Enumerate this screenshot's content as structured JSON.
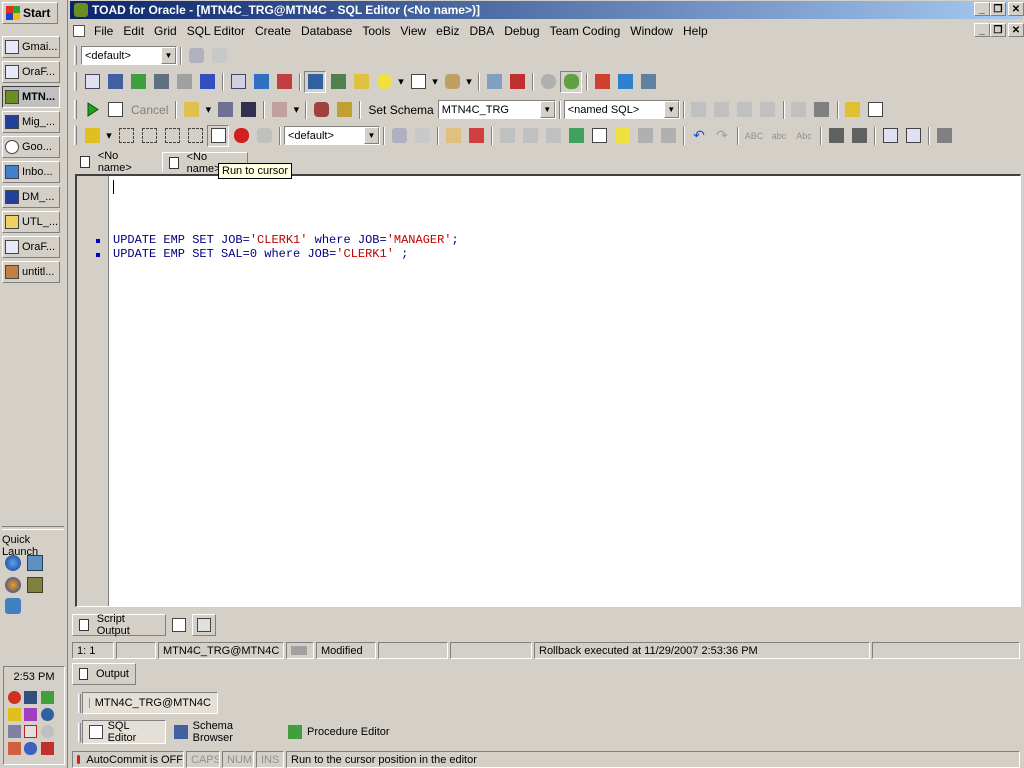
{
  "taskbar": {
    "start_label": "Start",
    "tasks": [
      {
        "label": "Gmai..."
      },
      {
        "label": "OraF..."
      },
      {
        "label": "MTN..."
      },
      {
        "label": "Mig_..."
      },
      {
        "label": "Goo..."
      },
      {
        "label": "Inbo..."
      },
      {
        "label": "DM_..."
      },
      {
        "label": "UTL_..."
      },
      {
        "label": "OraF..."
      },
      {
        "label": "untitl..."
      }
    ],
    "quick_launch_label": "Quick Launch",
    "clock": "2:53 PM"
  },
  "window": {
    "title": "TOAD for Oracle - [MTN4C_TRG@MTN4C - SQL Editor (<No name>)]"
  },
  "menu": {
    "items": [
      {
        "label": "File"
      },
      {
        "label": "Edit"
      },
      {
        "label": "Grid"
      },
      {
        "label": "SQL Editor"
      },
      {
        "label": "Create"
      },
      {
        "label": "Database"
      },
      {
        "label": "Tools"
      },
      {
        "label": "View"
      },
      {
        "label": "eBiz"
      },
      {
        "label": "DBA"
      },
      {
        "label": "Debug"
      },
      {
        "label": "Team Coding"
      },
      {
        "label": "Window"
      },
      {
        "label": "Help"
      }
    ]
  },
  "toolbar1": {
    "profile_combo": "<default>"
  },
  "toolbar3": {
    "cancel_label": "Cancel",
    "set_schema_label": "Set Schema",
    "schema_value": "MTN4C_TRG",
    "named_sql_value": "<named SQL>"
  },
  "toolbar4": {
    "default_combo": "<default>"
  },
  "tabs": [
    {
      "label": "<No name>"
    },
    {
      "label": "<No name>"
    }
  ],
  "tooltip": "Run to cursor",
  "editor": {
    "line1": {
      "kw1": "UPDATE EMP SET ",
      "p1": "JOB=",
      "s1": "'CLERK1'",
      "kw2": " where ",
      "p2": "JOB=",
      "s2": "'MANAGER'",
      "end": ";"
    },
    "line2": {
      "kw1": "UPDATE EMP SET ",
      "p1": "SAL=0",
      "kw2": " where ",
      "p2": "JOB=",
      "s2": "'CLERK1'",
      "end": " ;"
    }
  },
  "output_tabs": {
    "script_output": "Script Output"
  },
  "status1": {
    "position": "1:  1",
    "connection": "MTN4C_TRG@MTN4C",
    "modified": "Modified",
    "message": "Rollback executed at 11/29/2007 2:53:36 PM"
  },
  "output_label": "Output",
  "connection_tab": "MTN4C_TRG@MTN4C",
  "window_tabs": [
    {
      "label": "SQL Editor"
    },
    {
      "label": "Schema Browser"
    },
    {
      "label": "Procedure Editor"
    }
  ],
  "status2": {
    "autocommit": "AutoCommit is OFF",
    "caps": "CAPS",
    "num": "NUM",
    "ins": "INS",
    "hint": "Run to the cursor position in the editor"
  }
}
